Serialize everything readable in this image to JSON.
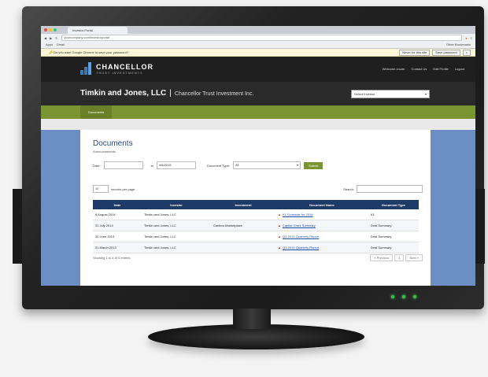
{
  "browser": {
    "tab_title": "Investor Portal",
    "url": "yourcompany.com/investorportal",
    "bookmarks": [
      "Apps",
      "Gmail"
    ],
    "other_bookmarks": "Other Bookmarks",
    "infobar_text": "Do you want Google Chrome to save your password?",
    "infobar_buttons": [
      "Never for this site",
      "Save password"
    ]
  },
  "site": {
    "brand_top": "CHANCELLOR",
    "brand_bottom": "TRUST INVESTMENTS",
    "nav": [
      "Welcome cruzer",
      "Contact Us",
      "Edit Profile",
      "Logout"
    ],
    "company": "Timkin and Jones, LLC",
    "separator": "|",
    "investment_firm": "Chancellor Trust Investment Inc.",
    "investor_select": "Select Investor",
    "tab_documents": "Documents"
  },
  "documents": {
    "title": "Documents",
    "subtitle": "Announcements",
    "date_label": "Date:",
    "to_label": "to",
    "to_value": "4/8/2015",
    "doctype_label": "Document Type:",
    "doctype_value": "All",
    "go_button": "Submit",
    "per_page_value": "10",
    "per_page_label": "records per page",
    "search_label": "Search:",
    "columns": [
      "Date",
      "Investor",
      "Investment",
      "Document Name",
      "Document Type"
    ],
    "rows": [
      {
        "date": "8 August 2014",
        "investor": "Timkin and Jones, LLC",
        "investment": "",
        "doc": "K1 Schedule for 2014",
        "type": "K1"
      },
      {
        "date": "31 July 2014",
        "investor": "Timkin and Jones, LLC",
        "investment": "Caribou Marketplace",
        "doc": "Capital Grant Summary",
        "type": "Deal Summary"
      },
      {
        "date": "30 June 2013",
        "investor": "Timkin and Jones, LLC",
        "investment": "",
        "doc": "Q2-2013 Quarterly Report",
        "type": "Deal Summary"
      },
      {
        "date": "31 March 2013",
        "investor": "Timkin and Jones, LLC",
        "investment": "",
        "doc": "Q1-2013 Quarterly Report",
        "type": "Deal Summary"
      }
    ],
    "showing": "Showing 1 to 4 of 4 entries",
    "pager": [
      "« Previous",
      "1",
      "Next »"
    ]
  }
}
